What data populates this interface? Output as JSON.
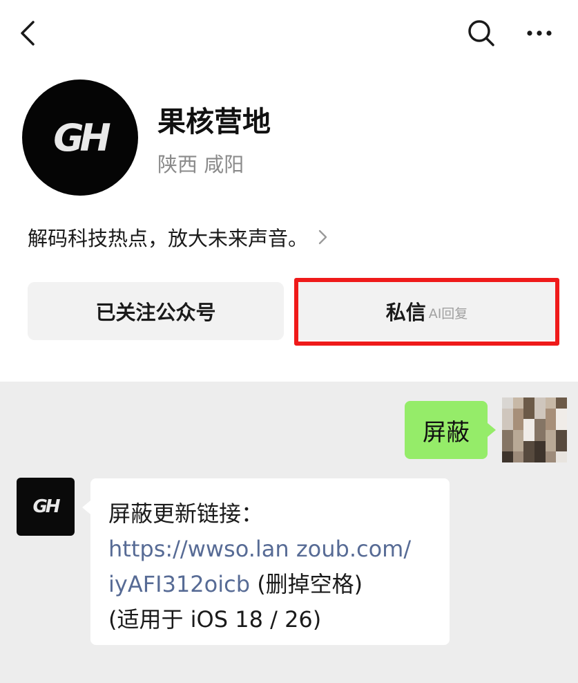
{
  "nav": {
    "back_icon": "chevron-left-icon",
    "search_icon": "search-icon",
    "more_icon": "more-horizontal-icon"
  },
  "profile": {
    "avatar_text": "GH",
    "name": "果核营地",
    "location": "陕西 咸阳",
    "description": "解码科技热点，放大未来声音。"
  },
  "actions": {
    "follow_label": "已关注公众号",
    "message_label": "私信",
    "message_sublabel": "AI回复"
  },
  "chat": {
    "outgoing_text": "屏蔽",
    "bot_avatar_text": "GH",
    "incoming_line1": "屏蔽更新链接：",
    "incoming_link_part1": "https://wwso.lan zoub.com/",
    "incoming_link_part2": "iyAFI312oicb",
    "incoming_note": " (删掉空格)",
    "incoming_line4": "(适用于 iOS 18 / 26)"
  },
  "colors": {
    "highlight": "#ef1a1a",
    "outgoing_bubble": "#95ec69",
    "link": "#576b95",
    "chat_background": "#ededed"
  }
}
